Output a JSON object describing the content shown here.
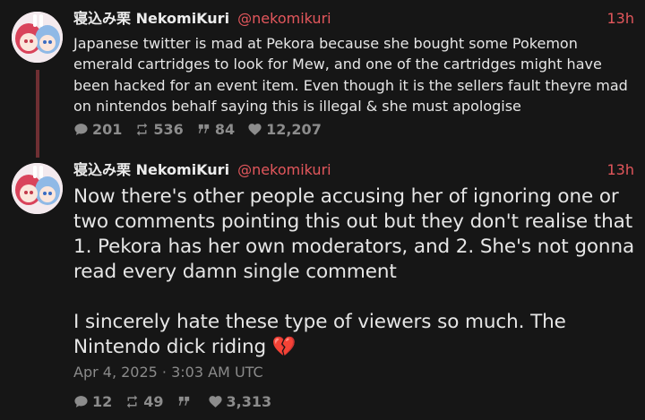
{
  "tweets": [
    {
      "display_name": "寝込み栗 NekomiKuri",
      "handle": "@nekomikuri",
      "time": "13h",
      "text": "Japanese twitter is mad at Pekora because she bought some Pokemon emerald cartridges to look for Mew, and one of the cartridges might have been hacked for an event item. Even though it is the sellers fault theyre mad on nintendos behalf saying this is illegal & she must apologise",
      "stats": {
        "replies": "201",
        "retweets": "536",
        "quotes": "84",
        "likes": "12,207"
      }
    },
    {
      "display_name": "寝込み栗 NekomiKuri",
      "handle": "@nekomikuri",
      "time": "13h",
      "text": "Now there's other people accusing her of ignoring one or two comments pointing this out but they don't realise that 1. Pekora has her own moderators, and 2. She's not gonna read every damn single comment\n\nI sincerely hate these type of viewers so much. The Nintendo dick riding 💔",
      "date": "Apr 4, 2025 · 3:03 AM UTC",
      "stats": {
        "replies": "12",
        "retweets": "49",
        "quotes": "",
        "likes": "3,313"
      }
    }
  ],
  "colors": {
    "background": "#161616",
    "accent": "#e3575c",
    "thread_line": "#6f2f33",
    "muted": "#8c8c8c"
  },
  "icons": [
    "avatar",
    "reply-icon",
    "retweet-icon",
    "quote-icon",
    "heart-icon"
  ]
}
